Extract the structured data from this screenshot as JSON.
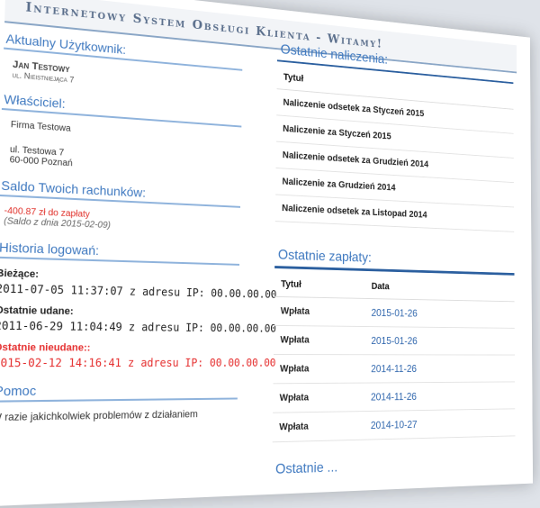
{
  "banner": {
    "title": "Internetowy System Obsługi Klienta - Witamy!"
  },
  "user": {
    "heading": "Aktualny Użytkownik:",
    "name": "Jan Testowy",
    "address": "ul. Nieistniejąca 7"
  },
  "owner": {
    "heading": "Właściciel:",
    "name": "Firma Testowa",
    "street": "ul. Testowa 7",
    "city": "60-000 Poznań"
  },
  "balance": {
    "heading": "Saldo Twoich rachunków:",
    "amount": "-400.87 zł do zapłaty",
    "date_note": "(Saldo z dnia 2015-02-09)"
  },
  "login_history": {
    "heading": "Historia logowań:",
    "current_label": "Bieżące:",
    "current_value": "2011-07-05 11:37:07 z adresu IP: 00.00.00.00",
    "last_success_label": "Ostatnie udane:",
    "last_success_value": "2011-06-29 11:04:49 z adresu IP: 00.00.00.00",
    "last_failed_label": "Ostatnie nieudane::",
    "last_failed_value": "2015-02-12 14:16:41 z adresu IP: 00.00.00.00"
  },
  "help": {
    "heading": "Pomoc",
    "text": "W razie jakichkolwiek problemów z działaniem"
  },
  "charges": {
    "heading": "Ostatnie naliczenia:",
    "column": "Tytuł",
    "rows": [
      "Naliczenie odsetek za Styczeń 2015",
      "Naliczenie za Styczeń 2015",
      "Naliczenie odsetek za Grudzień 2014",
      "Naliczenie za Grudzień 2014",
      "Naliczenie odsetek za Listopad 2014"
    ]
  },
  "payments": {
    "heading": "Ostatnie zapłaty:",
    "col_title": "Tytuł",
    "col_date": "Data",
    "rows": [
      {
        "title": "Wpłata",
        "date": "2015-01-26"
      },
      {
        "title": "Wpłata",
        "date": "2015-01-26"
      },
      {
        "title": "Wpłata",
        "date": "2014-11-26"
      },
      {
        "title": "Wpłata",
        "date": "2014-11-26"
      },
      {
        "title": "Wpłata",
        "date": "2014-10-27"
      }
    ]
  },
  "next_section": {
    "heading": "Ostatnie ..."
  }
}
